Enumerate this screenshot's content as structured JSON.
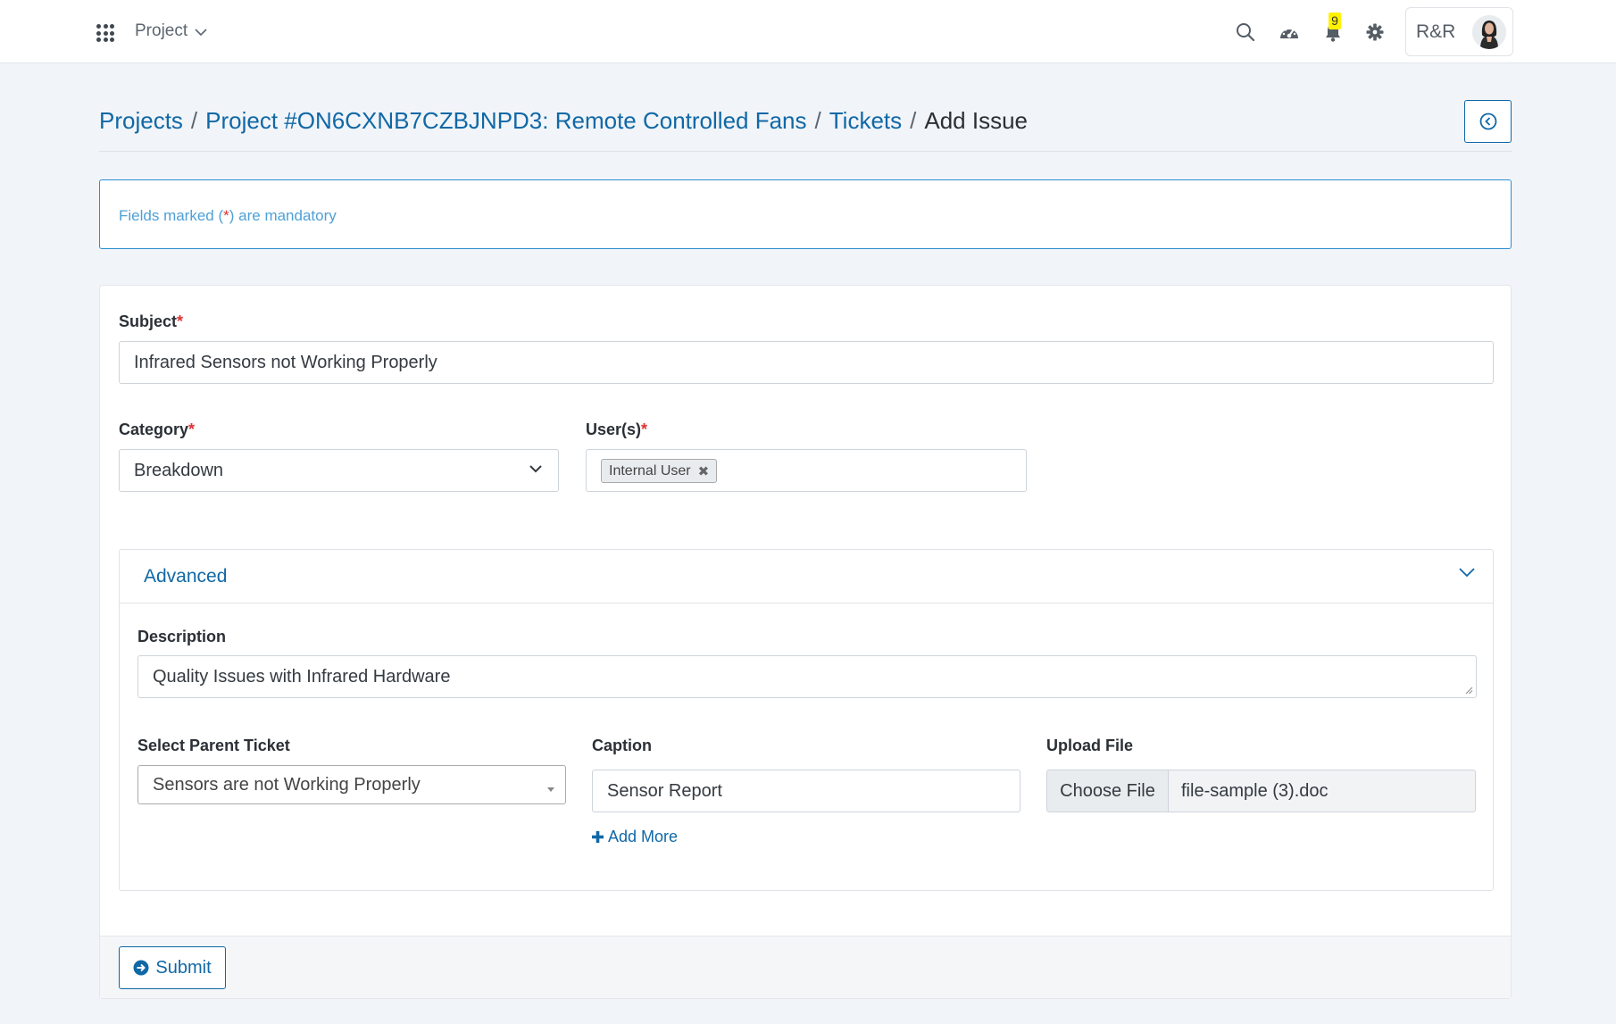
{
  "header": {
    "project_menu_label": "Project",
    "notification_count": "9",
    "user_initials": "R&R"
  },
  "breadcrumb": {
    "items": [
      "Projects",
      "Project #ON6CXNB7CZBJNPD3: Remote Controlled Fans",
      "Tickets"
    ],
    "current": "Add Issue",
    "separator": "/"
  },
  "notice": {
    "prefix": "Fields marked (",
    "star": "*",
    "suffix": ") are mandatory"
  },
  "form": {
    "subject_label": "Subject",
    "subject_value": "Infrared Sensors not Working Properly",
    "category_label": "Category",
    "category_value": "Breakdown",
    "users_label": "User(s)",
    "users_tag": "Internal User",
    "required_mark": "*",
    "advanced": {
      "title": "Advanced",
      "description_label": "Description",
      "description_value": "Quality Issues with Infrared Hardware",
      "parent_ticket_label": "Select Parent Ticket",
      "parent_ticket_value": "Sensors are not Working Properly",
      "caption_label": "Caption",
      "caption_value": "Sensor Report",
      "add_more_label": "Add More",
      "upload_label": "Upload File",
      "choose_file_label": "Choose File",
      "file_name": "file-sample (3).doc"
    },
    "submit_label": "Submit"
  },
  "colors": {
    "primary": "#1068a6",
    "required": "#e03131",
    "badge": "#fff200"
  }
}
